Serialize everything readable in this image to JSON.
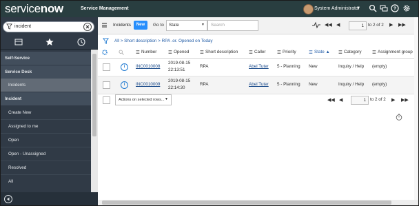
{
  "header": {
    "brand_service": "service",
    "brand_now": "now",
    "subtitle": "Service Management",
    "user_name": "System Administrator",
    "user_caret": "▼",
    "icons": [
      "search-icon",
      "chat-icon",
      "help-icon",
      "gear-icon"
    ]
  },
  "sidebar": {
    "filter_value": "incident",
    "tabs": [
      "archive-icon",
      "star-icon",
      "history-icon"
    ],
    "items": [
      {
        "label": "Self-Service",
        "kind": "app"
      },
      {
        "label": "Service Desk",
        "kind": "app"
      },
      {
        "label": "Incidents",
        "kind": "module",
        "active": true
      },
      {
        "label": "Incident",
        "kind": "app"
      },
      {
        "label": "Create New",
        "kind": "module"
      },
      {
        "label": "Assigned to me",
        "kind": "module"
      },
      {
        "label": "Open",
        "kind": "module"
      },
      {
        "label": "Open - Unassigned",
        "kind": "module"
      },
      {
        "label": "Resolved",
        "kind": "module"
      },
      {
        "label": "All",
        "kind": "module"
      }
    ]
  },
  "listbar": {
    "title": "Incidents",
    "new_label": "New",
    "goto_label": "Go to",
    "goto_field": "State",
    "search_placeholder": "Search",
    "page_value": "1",
    "page_total": "to 2 of 2"
  },
  "breadcrumb": "All > Short description > RPA .or. Opened on Today",
  "table": {
    "columns": [
      "Number",
      "Opened",
      "Short description",
      "Caller",
      "Priority",
      "State",
      "Category",
      "Assignment group"
    ],
    "sort_indicator": "▲",
    "rows": [
      {
        "number": "INC0010008",
        "opened_date": "2019-08-15",
        "opened_time": "22:13:51",
        "short_description": "RPA",
        "caller": "Abel Tuter",
        "priority": "5 - Planning",
        "state": "New",
        "category": "Inquiry / Help",
        "assignment_group": "(empty)"
      },
      {
        "number": "INC0010009",
        "opened_date": "2019-08-15",
        "opened_time": "22:14:30",
        "short_description": "RPA",
        "caller": "Abel Tuter",
        "priority": "5 - Planning",
        "state": "New",
        "category": "Inquiry / Help",
        "assignment_group": "(empty)"
      }
    ]
  },
  "footer": {
    "actions_label": "Actions on selected rows...",
    "page_value": "1",
    "page_total": "to 2 of 2"
  },
  "colors": {
    "topbar": "#293e40",
    "sidebar": "#303a46",
    "accent": "#278efc"
  }
}
